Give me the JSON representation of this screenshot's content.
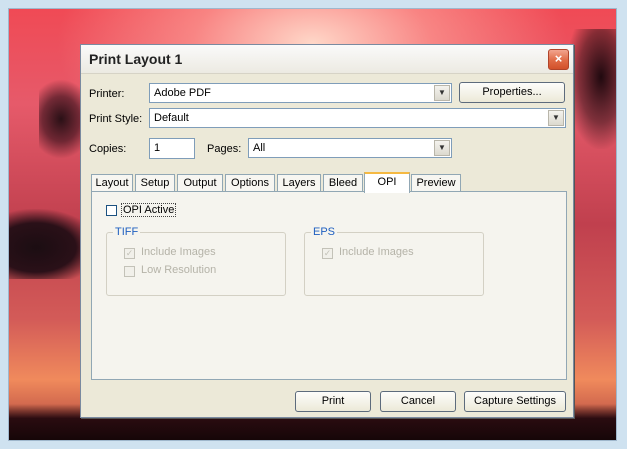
{
  "dialog": {
    "title": "Print Layout 1",
    "close_glyph": "×"
  },
  "printer": {
    "label": "Printer:",
    "value": "Adobe PDF",
    "properties_button": "Properties..."
  },
  "print_style": {
    "label": "Print Style:",
    "value": "Default"
  },
  "copies": {
    "label": "Copies:",
    "value": "1"
  },
  "pages": {
    "label": "Pages:",
    "value": "All"
  },
  "tabs": [
    "Layout",
    "Setup",
    "Output",
    "Options",
    "Layers",
    "Bleed",
    "OPI",
    "Preview"
  ],
  "active_tab": "OPI",
  "opi": {
    "active_label": "OPI Active",
    "tiff": {
      "title": "TIFF",
      "include_images": "Include Images",
      "low_resolution": "Low Resolution"
    },
    "eps": {
      "title": "EPS",
      "include_images": "Include Images"
    }
  },
  "footer": {
    "print": "Print",
    "cancel": "Cancel",
    "capture": "Capture Settings"
  },
  "icons": {
    "dropdown": "chevron-down-icon",
    "check": "check-icon"
  }
}
